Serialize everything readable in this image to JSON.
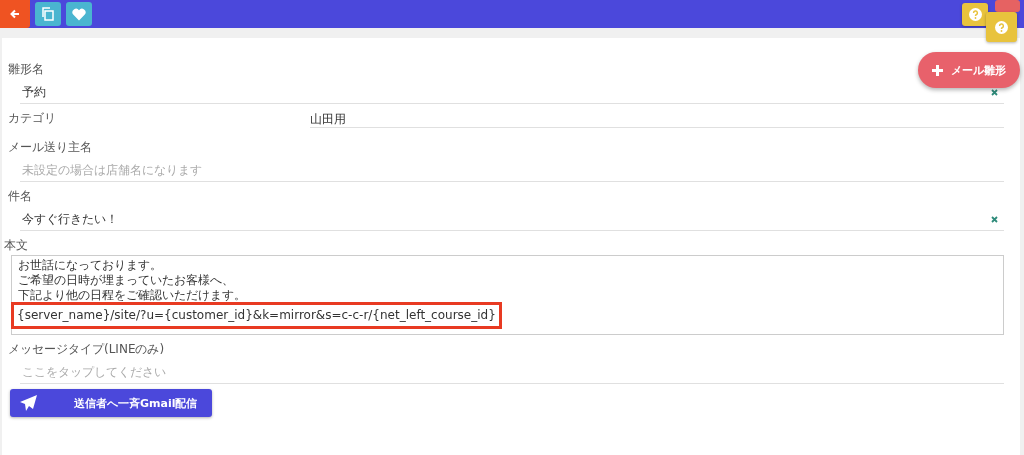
{
  "toolbar": {
    "buttons": [
      {
        "kind": "back"
      },
      {
        "kind": "copy"
      },
      {
        "kind": "favorite"
      }
    ]
  },
  "fab": {
    "label": "メール雛形"
  },
  "fields": [
    {
      "kind": "text",
      "label": "雛形名",
      "value": "予約",
      "clearable": true
    },
    {
      "kind": "select",
      "label": "カテゴリ",
      "value": "山田用"
    },
    {
      "kind": "text",
      "label": "メール送り主名",
      "placeholder": "未設定の場合は店舗名になります",
      "clearable": false
    },
    {
      "kind": "text",
      "label": "件名",
      "value": "今すぐ行きたい！",
      "clearable": true
    },
    {
      "kind": "textarea",
      "label": "本文",
      "lines": [
        {
          "text": "お世話になっております。",
          "highlighted": false
        },
        {
          "text": "ご希望の日時が埋まっていたお客様へ、",
          "highlighted": false
        },
        {
          "text": "下記より他の日程をご確認いただけます。",
          "highlighted": false
        },
        {
          "text": "{server_name}/site/?u={customer_id}&k=mirror&s=c-c-r/{net_left_course_id}",
          "highlighted": true
        }
      ]
    },
    {
      "kind": "text",
      "label": "メッセージタイプ(LINEのみ)",
      "placeholder": "ここをタップしてください",
      "clearable": false
    }
  ],
  "submit": {
    "label": "送信者へ一斉Gmail配信"
  }
}
